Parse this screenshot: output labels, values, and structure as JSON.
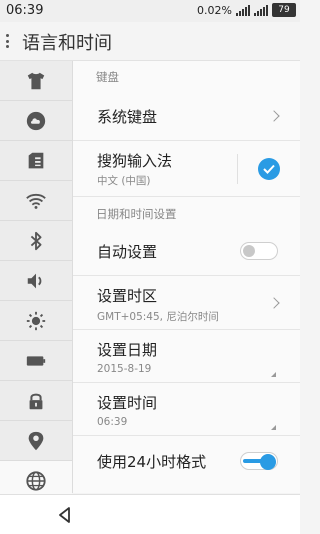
{
  "status_bar": {
    "time": "06:39",
    "data_rate": "0.02%",
    "battery": "79"
  },
  "header": {
    "title": "语言和时间"
  },
  "sidebar": {
    "items": [
      {
        "icon": "shirt-icon"
      },
      {
        "icon": "cloud-icon"
      },
      {
        "icon": "sim-card-icon"
      },
      {
        "icon": "wifi-icon"
      },
      {
        "icon": "bluetooth-icon"
      },
      {
        "icon": "volume-icon"
      },
      {
        "icon": "brightness-icon"
      },
      {
        "icon": "battery-icon"
      },
      {
        "icon": "lock-icon"
      },
      {
        "icon": "location-icon"
      },
      {
        "icon": "globe-icon"
      }
    ],
    "active_index": 10
  },
  "sections": {
    "keyboard": {
      "title": "键盘",
      "system_keyboard": {
        "title": "系统键盘"
      },
      "sogou": {
        "title": "搜狗输入法",
        "subtitle": "中文 (中国)",
        "checked": true
      }
    },
    "datetime": {
      "title": "日期和时间设置",
      "auto": {
        "title": "自动设置",
        "enabled": false
      },
      "timezone": {
        "title": "设置时区",
        "value": "GMT+05:45, 尼泊尔时间"
      },
      "date": {
        "title": "设置日期",
        "value": "2015-8-19"
      },
      "time": {
        "title": "设置时间",
        "value": "06:39"
      },
      "format24": {
        "title": "使用24小时格式",
        "enabled": true
      }
    }
  },
  "colors": {
    "accent": "#2a9be4"
  }
}
